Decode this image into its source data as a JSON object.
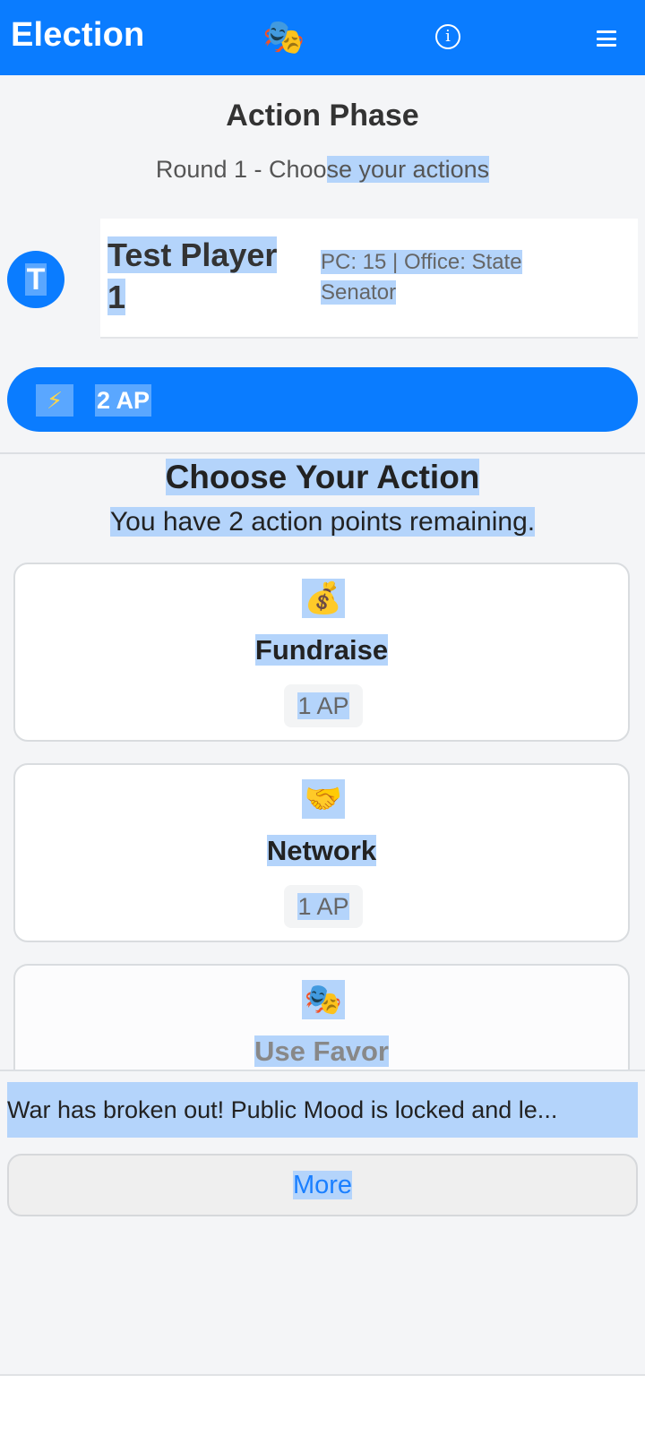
{
  "header": {
    "title": "Election",
    "logo_glyph": "🎭",
    "info_glyph": "i",
    "brand_color": "#0a7cff"
  },
  "phase": {
    "title": "Action Phase",
    "subtitle_plain": "Round 1 - Choo",
    "subtitle_selected": "se your actions"
  },
  "player": {
    "avatar_letter": "T",
    "name": "Test Player 1",
    "stats": "PC: 15 | Office: State Senator"
  },
  "ap": {
    "icon_glyph": "⚡",
    "label": "2 AP"
  },
  "actions_section": {
    "title": "Choose Your Action",
    "subtitle": "You have 2 action points remaining."
  },
  "actions": [
    {
      "icon": "💰",
      "icon_name": "money-bag-icon",
      "label": "Fundraise",
      "cost": "1 AP",
      "enabled": true
    },
    {
      "icon": "🤝",
      "icon_name": "handshake-icon",
      "label": "Network",
      "cost": "1 AP",
      "enabled": true
    },
    {
      "icon": "🎭",
      "icon_name": "masks-icon",
      "label": "Use Favor",
      "enabled": false
    }
  ],
  "event": {
    "text": "War has broken out! Public Mood is locked and le...",
    "more_label": "More"
  },
  "colors": {
    "selection_highlight": "#b4d4fb",
    "background": "#f4f5f7"
  }
}
